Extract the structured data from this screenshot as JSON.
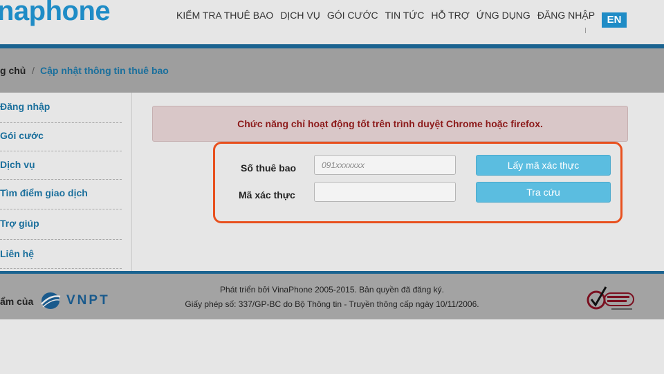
{
  "header": {
    "logo_text": "naphone",
    "nav": [
      "KIỂM TRA THUÊ BAO",
      "DỊCH VỤ",
      "GÓI CƯỚC",
      "TIN TỨC",
      "HỖ TRỢ",
      "ỨNG DỤNG",
      "ĐĂNG NHẬP"
    ],
    "lang_button": "EN"
  },
  "breadcrumb": {
    "home": "g chủ",
    "separator": "/",
    "current": "Cập nhật thông tin thuê bao"
  },
  "sidebar": {
    "items": [
      "Đăng nhập",
      "Gói cước",
      "Dịch vụ",
      "Tìm điểm giao dịch",
      "Trợ giúp",
      "Liên hệ"
    ]
  },
  "alert": {
    "text": "Chức năng chỉ hoạt động tốt trên trình duyệt Chrome hoặc firefox."
  },
  "form": {
    "subscriber_label": "Số thuê bao",
    "subscriber_placeholder": "091xxxxxxx",
    "code_label": "Mã xác thực",
    "code_value": "",
    "get_code_button": "Lấy mã xác thực",
    "lookup_button": "Tra cứu"
  },
  "footer": {
    "brand_prefix": "ẩm của",
    "vnpt_text": "VNPT",
    "line1": "Phát triển bởi VinaPhone 2005-2015. Bản quyền đã đăng ký.",
    "line2": "Giấy phép số: 337/GP-BC do Bộ Thông tin - Truyền thông cấp ngày 10/11/2006."
  },
  "colors": {
    "brand_blue": "#1f8cc6",
    "dark_blue": "#1a6390",
    "highlight_orange": "#e8501e",
    "button_blue": "#5bbde0",
    "alert_text": "#8c1a1a"
  }
}
